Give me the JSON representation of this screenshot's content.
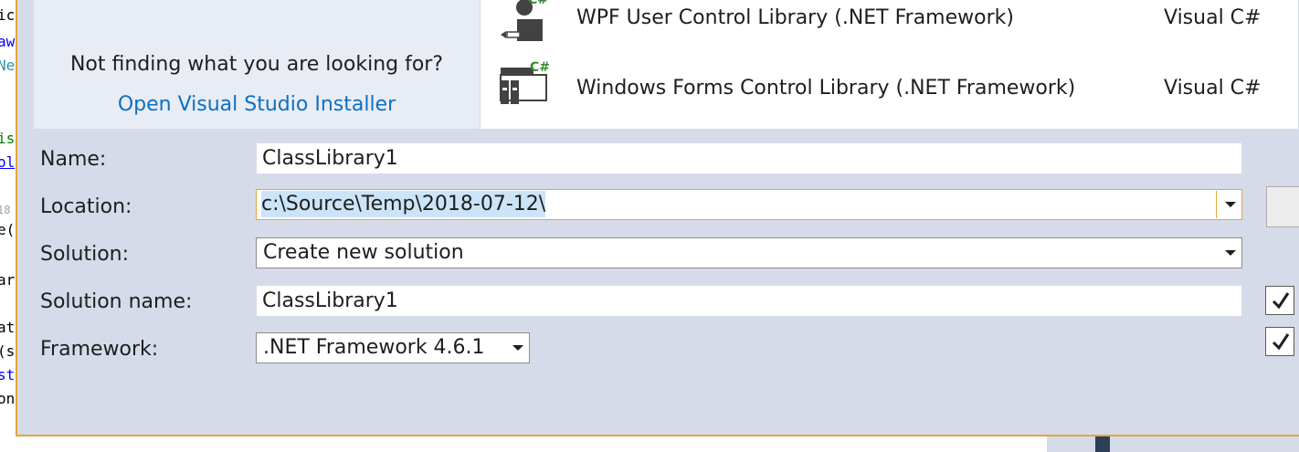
{
  "background_editor": {
    "code_fragments": [
      {
        "text": "ic",
        "color": "#1e1e1e"
      },
      {
        "text": "aw",
        "color": "#0000ff"
      },
      {
        "text": "Ne",
        "color": "#2b91af"
      },
      {
        "text": "is",
        "color": "#008000"
      },
      {
        "text": "ol",
        "color": "#0000ff"
      },
      {
        "text": "18",
        "color": "#a0a0a0"
      },
      {
        "text": "e(",
        "color": "#1e1e1e"
      },
      {
        "text": "ar",
        "color": "#1e1e1e"
      },
      {
        "text": "at",
        "color": "#1e1e1e"
      },
      {
        "text": "(s",
        "color": "#1e1e1e"
      },
      {
        "text": "st",
        "color": "#0000ff"
      },
      {
        "text": "on",
        "color": "#1e1e1e"
      }
    ]
  },
  "left_pane": {
    "prompt": "Not finding what you are looking for?",
    "installer_link": "Open Visual Studio Installer"
  },
  "templates": [
    {
      "name": "WPF User Control Library (.NET Framework)",
      "language": "Visual C#",
      "icon": "wpf-user-control-library-icon",
      "badge": "C#"
    },
    {
      "name": "Windows Forms Control Library (.NET Framework)",
      "language": "Visual C#",
      "icon": "windows-forms-control-library-icon",
      "badge": "C#"
    }
  ],
  "form": {
    "name_label": "Name:",
    "name_value": "ClassLibrary1",
    "location_label": "Location:",
    "location_value": "c:\\Source\\Temp\\2018-07-12\\",
    "solution_label": "Solution:",
    "solution_value": "Create new solution",
    "solution_name_label": "Solution name:",
    "solution_name_value": "ClassLibrary1",
    "framework_label": "Framework:",
    "framework_value": ".NET Framework 4.6.1"
  },
  "checkboxes": [
    {
      "name": "create-directory-checkbox",
      "checked": true
    },
    {
      "name": "add-source-control-checkbox",
      "checked": true
    }
  ],
  "colors": {
    "dialog_bg": "#d6dbe9",
    "accent_border": "#e5a63c",
    "link": "#0e70c0",
    "csharp_badge": "#388a34",
    "selection": "#cce4f7"
  }
}
